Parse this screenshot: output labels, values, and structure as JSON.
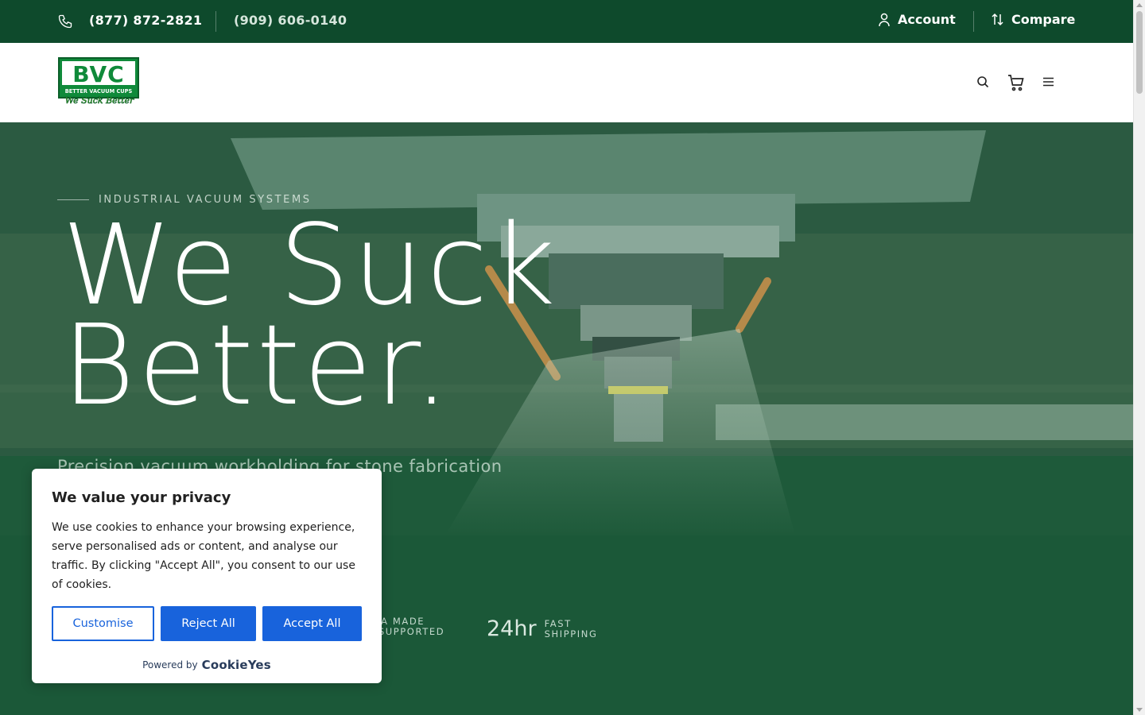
{
  "topbar": {
    "phone_primary": "(877) 872-2821",
    "phone_secondary": "(909) 606-0140",
    "account_label": "Account",
    "compare_label": "Compare"
  },
  "header": {
    "logo_text": "BVC",
    "logo_subtext": "BETTER VACUUM CUPS",
    "logo_tagline": "We Suck Better"
  },
  "hero": {
    "eyebrow": "INDUSTRIAL VACUUM SYSTEMS",
    "headline_line1": "We Suck",
    "headline_line2": "Better.",
    "subheadline": "Precision vacuum workholding for stone fabrication",
    "stats": [
      {
        "value": "",
        "label_line1": "USA MADE",
        "label_line2": "& SUPPORTED"
      },
      {
        "value": "24hr",
        "label_line1": "FAST",
        "label_line2": "SHIPPING"
      }
    ]
  },
  "cookie_banner": {
    "title": "We value your privacy",
    "body": "We use cookies to enhance your browsing experience, serve personalised ads or content, and analyse our traffic. By clicking \"Accept All\", you consent to our use of cookies.",
    "customise_label": "Customise",
    "reject_label": "Reject All",
    "accept_label": "Accept All",
    "powered_by": "Powered by",
    "powered_brand": "CookieYes"
  },
  "colors": {
    "brand_green": "#0e4a2c",
    "accent_blue": "#1863dc"
  }
}
